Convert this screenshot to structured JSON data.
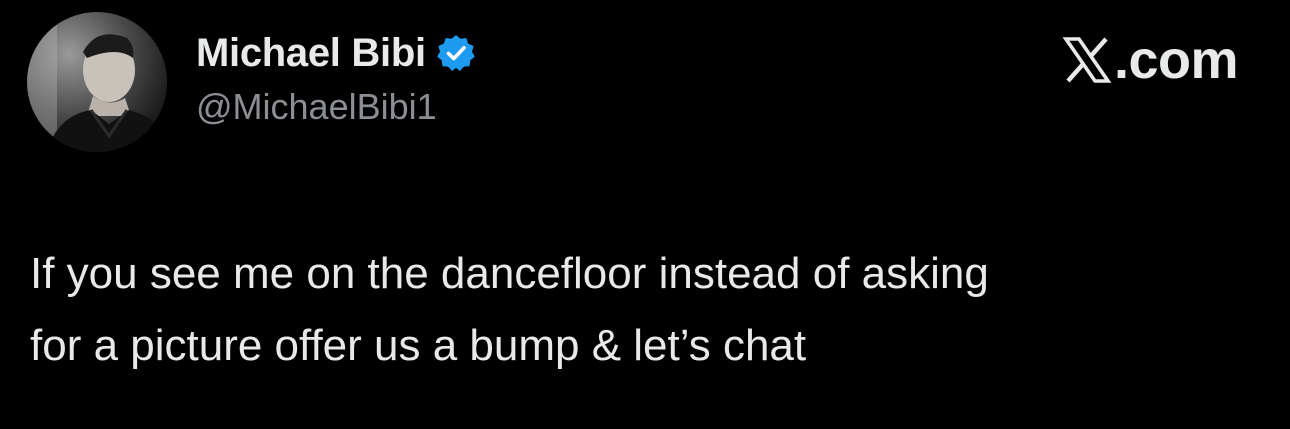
{
  "author": {
    "display_name": "Michael Bibi",
    "handle": "@MichaelBibi1",
    "verified_icon": "verified-badge-icon",
    "avatar_icon": "profile-photo"
  },
  "brand": {
    "logo_icon": "x-logo-icon",
    "suffix": ".com"
  },
  "tweet": {
    "lines": [
      "If you see me on the dancefloor instead of asking",
      "for a picture offer us a bump & let’s chat"
    ]
  },
  "colors": {
    "background": "#000000",
    "text": "#e7e9ea",
    "secondary_text": "#8b8f94",
    "verified_blue": "#1d9bf0"
  }
}
